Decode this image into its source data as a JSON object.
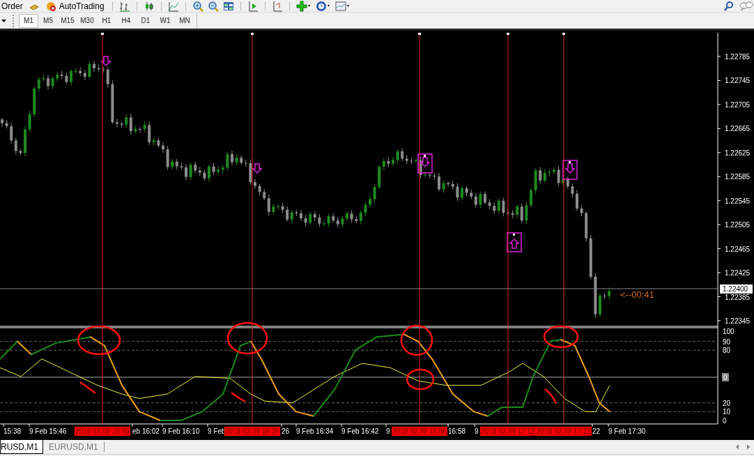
{
  "toolbar": {
    "buttons": [
      {
        "label": "Order"
      },
      {
        "label": "AutoTrading"
      }
    ]
  },
  "timeframes": [
    {
      "label": "M1",
      "selected": true
    },
    {
      "label": "M5",
      "selected": false
    },
    {
      "label": "M15",
      "selected": false
    },
    {
      "label": "M30",
      "selected": false
    },
    {
      "label": "H1",
      "selected": false
    },
    {
      "label": "H4",
      "selected": false
    },
    {
      "label": "D1",
      "selected": false
    },
    {
      "label": "W1",
      "selected": false
    },
    {
      "label": "MN",
      "selected": false
    }
  ],
  "chart": {
    "price_axis": [
      "1.22785",
      "1.22745",
      "1.22705",
      "1.22665",
      "1.22625",
      "1.22585",
      "1.22545",
      "1.22505",
      "1.22465",
      "1.22425",
      "1.22385",
      "1.22345"
    ],
    "current_price": "1.22400",
    "countdown": "<--00:41",
    "indicator_axis": [
      "100",
      "90",
      "80",
      "20",
      "10",
      "0"
    ],
    "indicator_zero": "0",
    "time_axis": [
      {
        "label": "15:38",
        "highlight": false
      },
      {
        "label": "9 Feb 15:46",
        "highlight": false
      },
      {
        "label": "2018.02.09 15:59",
        "highlight": true
      },
      {
        "label": "eb 16:02",
        "highlight": false
      },
      {
        "label": "9 Feb 16:10",
        "highlight": false
      },
      {
        "label": "9 Feb",
        "highlight": false
      },
      {
        "label": "2018.02.09 16:26",
        "highlight": true
      },
      {
        "label": "26",
        "highlight": false
      },
      {
        "label": "9 Feb 16:34",
        "highlight": false
      },
      {
        "label": "9 Feb 16:42",
        "highlight": false
      },
      {
        "label": "9",
        "highlight": false
      },
      {
        "label": "2018.02.09 16:56",
        "highlight": true
      },
      {
        "label": "16:58",
        "highlight": false
      },
      {
        "label": "9",
        "highlight": false
      },
      {
        "label": "2018.02.09 17:12",
        "highlight": true
      },
      {
        "label": "2018.02.09 17:22",
        "highlight": true
      },
      {
        "label": "22",
        "highlight": false
      },
      {
        "label": "9 Feb 17:30",
        "highlight": false
      }
    ]
  },
  "tabs": [
    {
      "label": "RUSD,M1",
      "selected": true
    },
    {
      "label": "EURUSD,M1",
      "selected": false
    }
  ]
}
